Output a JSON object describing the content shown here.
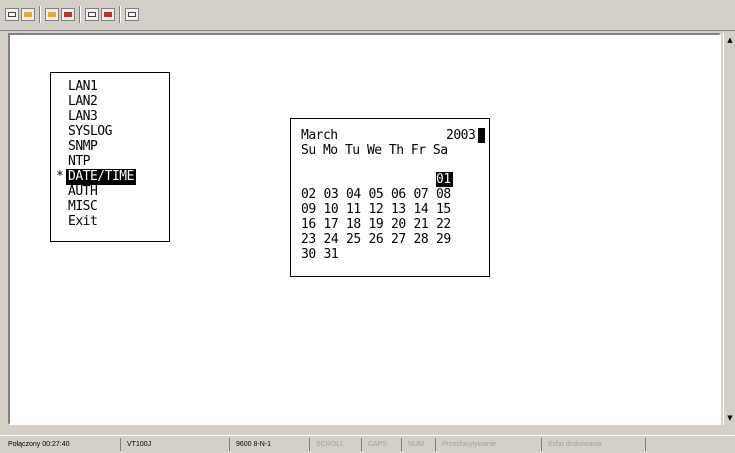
{
  "toolbar": {
    "buttons": [
      "new-icon",
      "open-icon",
      "connect-icon",
      "disconnect-icon",
      "send-icon",
      "receive-icon",
      "properties-icon"
    ]
  },
  "menu": {
    "items": [
      "LAN1",
      "LAN2",
      "LAN3",
      "SYSLOG",
      "SNMP",
      "NTP",
      "DATE/TIME",
      "AUTH",
      "MISC",
      "Exit"
    ],
    "selected_marker": "*"
  },
  "calendar": {
    "month": "March",
    "year": "2003",
    "weekdays": "Su Mo Tu We Th Fr Sa",
    "rows": [
      [
        "",
        "",
        "",
        "",
        "",
        "",
        "01"
      ],
      [
        "02",
        "03",
        "04",
        "05",
        "06",
        "07",
        "08"
      ],
      [
        "09",
        "10",
        "11",
        "12",
        "13",
        "14",
        "15"
      ],
      [
        "16",
        "17",
        "18",
        "19",
        "20",
        "21",
        "22"
      ],
      [
        "23",
        "24",
        "25",
        "26",
        "27",
        "28",
        "29"
      ],
      [
        "30",
        "31",
        "",
        "",
        "",
        "",
        ""
      ]
    ]
  },
  "status": {
    "connected": "Połączony 00:27:40",
    "emulation": "VT100J",
    "port_settings": "9600 8-N-1",
    "scroll": "SCROLL",
    "caps": "CAPS",
    "num": "NUM",
    "capture": "Przechwytywanie",
    "echo": "Echo drukowania"
  }
}
